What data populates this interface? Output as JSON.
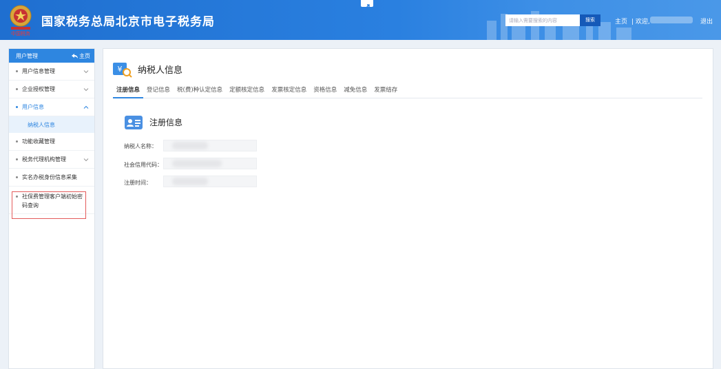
{
  "header": {
    "title": "国家税务总局北京市电子税务局",
    "search_placeholder": "请输入需要搜索的内容",
    "search_button": "搜索",
    "home_link": "主页",
    "welcome": "| 欢迎,",
    "logout": "退出",
    "emblem_caption": "中国税务"
  },
  "sidebar": {
    "title": "用户管理",
    "home_link": "主页",
    "items": [
      {
        "label": "用户信息管理"
      },
      {
        "label": "企业授权管理"
      },
      {
        "label": "用户信息"
      },
      {
        "label": "纳税人信息"
      },
      {
        "label": "功能收藏管理"
      },
      {
        "label": "税务代理机构管理"
      },
      {
        "label": "实名办税身份信息采集"
      },
      {
        "label": "社保费管理客户端初始密码查询"
      }
    ]
  },
  "main": {
    "page_title": "纳税人信息",
    "tabs": [
      {
        "label": "注册信息"
      },
      {
        "label": "登记信息"
      },
      {
        "label": "税(费)种认定信息"
      },
      {
        "label": "定额核定信息"
      },
      {
        "label": "发票核定信息"
      },
      {
        "label": "资格信息"
      },
      {
        "label": "减免信息"
      },
      {
        "label": "发票结存"
      }
    ],
    "section_title": "注册信息",
    "fields": [
      {
        "label": "纳税人名称：",
        "value": ""
      },
      {
        "label": "社会信用代码：",
        "value": ""
      },
      {
        "label": "注册时间：",
        "value": ""
      }
    ]
  },
  "colors": {
    "header_blue": "#2a80e0",
    "accent_blue": "#2e86e0",
    "highlight_red": "#e35a5a"
  }
}
